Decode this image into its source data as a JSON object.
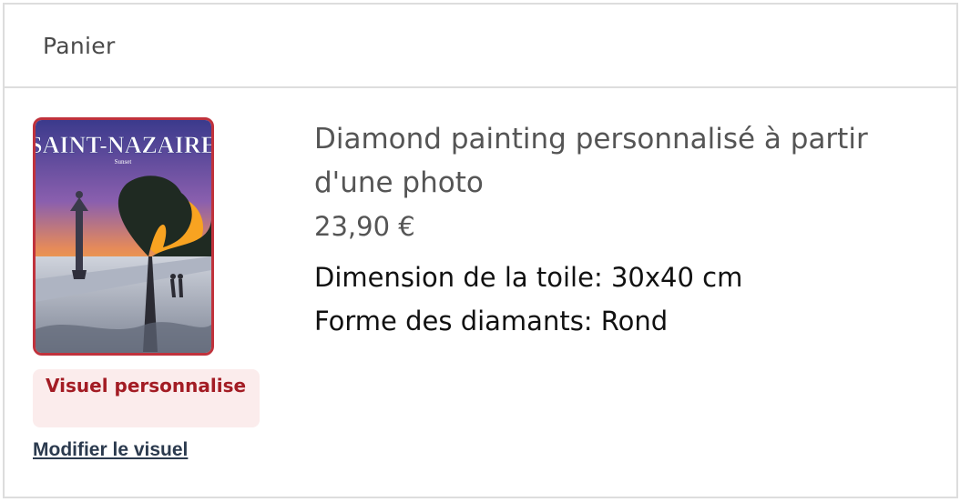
{
  "cart": {
    "title": "Panier"
  },
  "item": {
    "image": {
      "poster_title": "SAINT-NAZAIRE",
      "poster_subtitle": "Sunset"
    },
    "badge": "Visuel personnalise",
    "edit_link": "Modifier le visuel",
    "name": "Diamond painting personnalisé à partir d'une photo",
    "price": "23,90 €",
    "options": [
      "Dimension de la toile: 30x40 cm",
      "Forme des diamants: Rond"
    ]
  },
  "colors": {
    "accent_red": "#c0323c",
    "badge_bg": "#fbecec",
    "badge_text": "#a31c24",
    "link": "#2b3a4e"
  }
}
